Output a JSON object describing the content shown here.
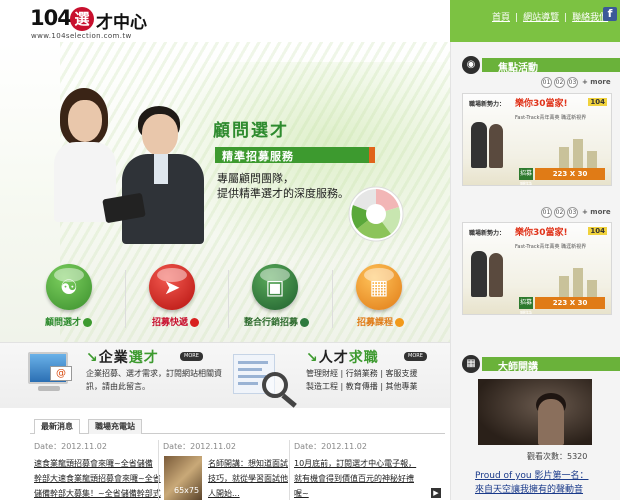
{
  "header": {
    "logo_number": "104",
    "logo_circle": "選",
    "logo_text": "才中心",
    "logo_url": "www.104selection.com.tw",
    "links": [
      "首頁",
      "網站導覽",
      "聯絡我們"
    ],
    "facebook_icon": "facebook-icon"
  },
  "hero": {
    "title": "顧問選才",
    "subtitle": "精準招募服務",
    "desc_line1": "專屬顧問團隊，",
    "desc_line2": "提供精準選才的深度服務。"
  },
  "menu": [
    {
      "label": "顧問選才",
      "color": "#4aa63a",
      "label_color": "#2e8b2e",
      "icon": "group-icon"
    },
    {
      "label": "招募快遞",
      "color": "#d8211f",
      "label_color": "#c8102e",
      "icon": "runner-icon"
    },
    {
      "label": "整合行銷招募",
      "color": "#2e7a3e",
      "label_color": "#2e6b2e",
      "icon": "monitor-icon"
    },
    {
      "label": "招募課程",
      "color": "#f29a1a",
      "label_color": "#e07b16",
      "icon": "presentation-icon"
    }
  ],
  "right": {
    "focus_title": "焦點活動",
    "pager": [
      "01",
      "02",
      "03"
    ],
    "more_label": "+ more",
    "banner_top": "職場新勢力：",
    "banner_title": "樂你30當家!",
    "banner_line": "Fast-Track青年菁英  職涯新視界",
    "banner_logo": "104",
    "banner_cta": "223 X 30",
    "banner_cta_left": "招募職缺",
    "masters_title": "大師開講",
    "views": "觀看次數：5320",
    "song_line1": "Proud of you 影片第一名：",
    "song_line2": "來自天空讓我擁有的聲動音"
  },
  "promo": {
    "company_title_1": "企業",
    "company_title_2": "選才",
    "company_more": "MORE",
    "company_line1": "企業招募、選才需求，訂閱網站相關資",
    "company_line2": "訊，請由此留言。",
    "talent_title_1": "人才",
    "talent_title_2": "求職",
    "talent_more": "MORE",
    "talent_line1": "管理財經 | 行銷業務 | 客服支援",
    "talent_line2": "製造工程 | 教育傳播 | 其他專業"
  },
  "news": {
    "tabs": [
      "最新消息",
      "職場充電站"
    ],
    "date_col1": "Date：2012.11.02",
    "date_col2": "Date：2012.11.02",
    "date_col3": "Date：2012.11.02",
    "col1_line1": "速食業龍頭招募會來囉~全省儲備",
    "col1_line2": "幹部大速食業龍頭招募會來囉~全省",
    "col1_line3": "儲備幹部大募集！~全省儲備幹部式",
    "col2_line1": "名師開講：想知道面試",
    "col2_line2": "技巧，就從學習面試他",
    "col2_line3": "人開始...",
    "col3_line1": "10月底前，訂閱選才中心電子報，",
    "col3_line2": "就有機會得到價值百元的神秘好禮",
    "col3_line3": "喔~",
    "thumb_label": "65x75"
  }
}
